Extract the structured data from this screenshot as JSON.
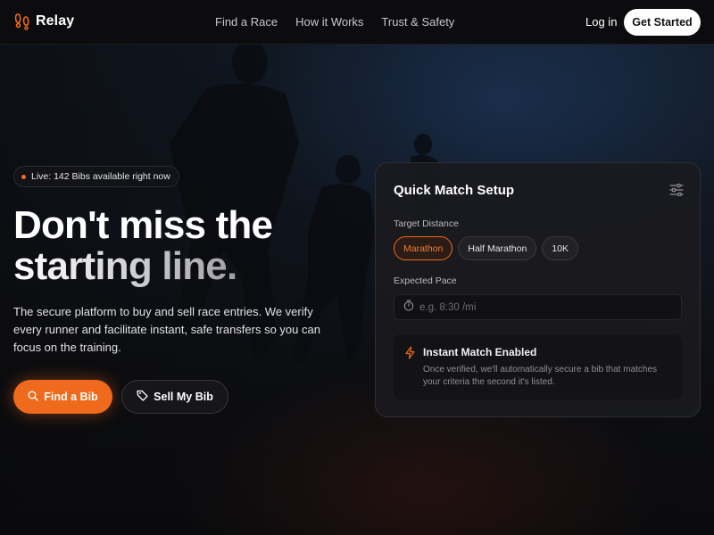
{
  "brand": {
    "name": "Relay",
    "accent": "#ef6a1c"
  },
  "nav": {
    "links": [
      "Find a Race",
      "How it Works",
      "Trust & Safety"
    ],
    "login": "Log in",
    "cta": "Get Started"
  },
  "hero": {
    "badge": "Live: 142 Bibs available right now",
    "headline_line1": "Don't miss the",
    "headline_line2": "starting line.",
    "lede": "The secure platform to buy and sell race entries. We verify every runner and facilitate instant, safe transfers so you can focus on the training.",
    "primary_button": "Find a Bib",
    "secondary_button": "Sell My Bib"
  },
  "card": {
    "title": "Quick Match Setup",
    "distance_label": "Target Distance",
    "distances": [
      "Marathon",
      "Half Marathon",
      "10K"
    ],
    "selected_distance": "Marathon",
    "pace_label": "Expected Pace",
    "pace_placeholder": "e.g. 8:30 /mi",
    "pace_value": "",
    "instant_title": "Instant Match Enabled",
    "instant_desc": "Once verified, we'll automatically secure a bib that matches your criteria the second it's listed."
  },
  "icons": {
    "logo": "running-feet-icon",
    "search": "search-icon",
    "tag": "tag-icon",
    "settings": "sliders-icon",
    "timer": "stopwatch-icon",
    "bolt": "lightning-icon"
  }
}
